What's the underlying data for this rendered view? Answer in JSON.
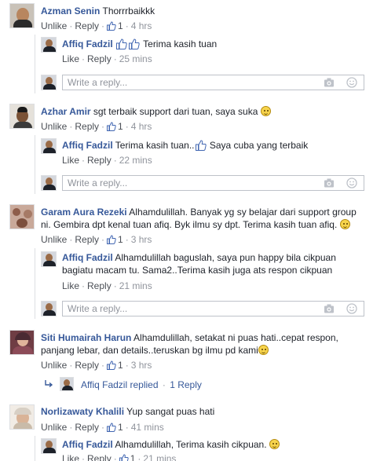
{
  "ui": {
    "like_label": "Like",
    "unlike_label": "Unlike",
    "reply_label": "Reply",
    "reply_placeholder": "Write a reply...",
    "dot": "·",
    "camera_icon": "camera-icon",
    "emoji_icon": "smiley-icon"
  },
  "comments": [
    {
      "name": "Azman Senin",
      "text": "Thorrrbaikkk",
      "like_label": "Unlike",
      "likes": "1",
      "time": "4 hrs",
      "reply": {
        "name": "Affiq Fadzil",
        "text": "Terima kasih tuan",
        "time": "25 mins"
      }
    },
    {
      "name": "Azhar Amir",
      "text": "sgt terbaik support dari tuan, saya suka",
      "like_label": "Unlike",
      "likes": "1",
      "time": "4 hrs",
      "reply": {
        "name": "Affiq Fadzil",
        "text": "Terima kasih tuan..",
        "text2": "Saya cuba yang terbaik",
        "time": "22 mins"
      }
    },
    {
      "name": "Garam Aura Rezeki",
      "text": "Alhamdulillah. Banyak yg sy belajar dari support group",
      "text_line2": "ni. Gembira dpt kenal tuan afiq. Byk ilmu sy dpt. Terima kasih tuan afiq.",
      "like_label": "Unlike",
      "likes": "1",
      "time": "3 hrs",
      "reply": {
        "name": "Affiq Fadzil",
        "text": "Alhamdulillah baguslah, saya pun happy bila cikpuan",
        "text_line2": "bagiatu macam tu. Sama2..Terima kasih juga ats respon cikpuan",
        "time": "21 mins"
      }
    },
    {
      "name": "Siti Humairah Harun",
      "text": "Alhamdulillah, setakat ni puas hati..cepat respon,",
      "text_line2": "panjang lebar, dan details..teruskan bg ilmu pd kami",
      "like_label": "Unlike",
      "likes": "1",
      "time": "3 hrs",
      "replied": {
        "name": "Affiq Fadzil",
        "label": "replied",
        "count": "1 Reply"
      }
    },
    {
      "name": "Norlizawaty Khalili",
      "text": "Yup sangat puas hati",
      "like_label": "Unlike",
      "likes": "1",
      "time": "41 mins",
      "reply": {
        "name": "Affiq Fadzil",
        "text": "Alhamdulillah, Terima kasih cikpuan.",
        "likes": "1",
        "time": "21 mins"
      }
    }
  ],
  "colors": {
    "name_link": "#365899",
    "meta_grey": "#90949c",
    "like_blue": "#4267b2",
    "border": "#dddfe2"
  }
}
